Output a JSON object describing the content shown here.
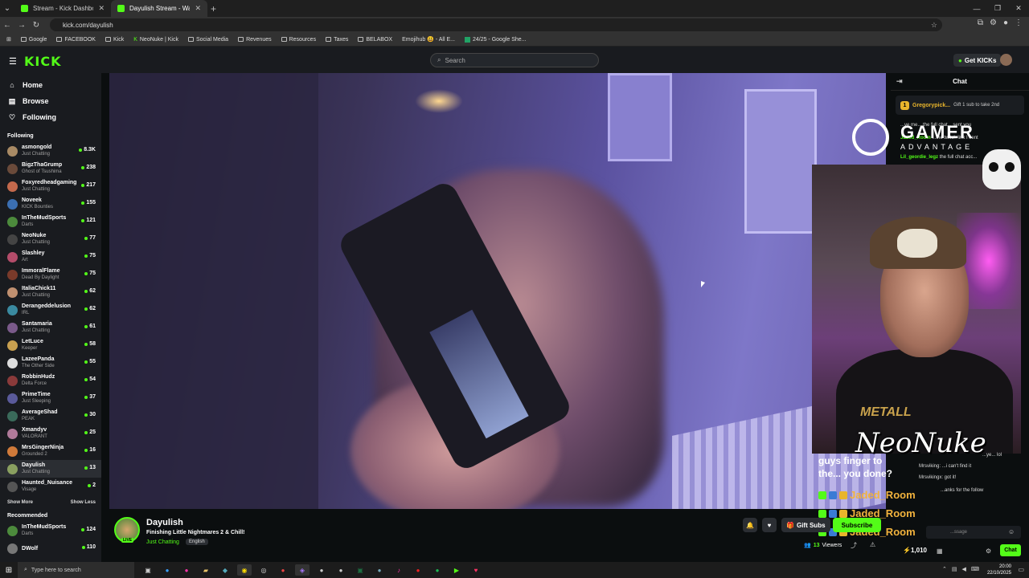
{
  "browser": {
    "tabs": [
      {
        "label": "Stream - Kick Dashboard",
        "active": false
      },
      {
        "label": "Dayulish Stream - Watch Live o",
        "active": true
      }
    ],
    "url": "kick.com/dayulish",
    "bookmarks": [
      "Google",
      "FACEBOOK",
      "Kick",
      "NeoNuke | Kick",
      "Social Media",
      "Revenues",
      "Resources",
      "Taxes",
      "BELABOX",
      "Emojihub 😃 - All E...",
      "24/25 - Google She..."
    ]
  },
  "header": {
    "logo": "KICK",
    "search_placeholder": "Search",
    "get_kicks": "Get KICKs"
  },
  "sidebar": {
    "nav": [
      {
        "label": "Home",
        "icon": "home-icon"
      },
      {
        "label": "Browse",
        "icon": "browse-icon"
      },
      {
        "label": "Following",
        "icon": "heart-icon"
      }
    ],
    "following_title": "Following",
    "following": [
      {
        "name": "asmongold",
        "category": "Just Chatting",
        "viewers": "8.3K",
        "color": "#a88a64"
      },
      {
        "name": "BigzThaGrump",
        "category": "Ghost of Tsushima",
        "viewers": "238",
        "color": "#6a4a3a"
      },
      {
        "name": "Foxyredheadgaming",
        "category": "Just Chatting",
        "viewers": "217",
        "color": "#c4694c"
      },
      {
        "name": "Noveek",
        "category": "KICK Bounties",
        "viewers": "155",
        "color": "#3b6fb2"
      },
      {
        "name": "InTheMudSports",
        "category": "Darts",
        "viewers": "121",
        "color": "#4c8a3c"
      },
      {
        "name": "NeoNuke",
        "category": "Just Chatting",
        "viewers": "77",
        "color": "#444"
      },
      {
        "name": "Slashley",
        "category": "Art",
        "viewers": "75",
        "color": "#b44c6a"
      },
      {
        "name": "ImmoralFlame",
        "category": "Dead By Daylight",
        "viewers": "75",
        "color": "#7a3a2a"
      },
      {
        "name": "ItaliaChick11",
        "category": "Just Chatting",
        "viewers": "62",
        "color": "#c09070"
      },
      {
        "name": "Derangeddelusion",
        "category": "IRL",
        "viewers": "62",
        "color": "#3a8aa0"
      },
      {
        "name": "Santamaria",
        "category": "Just Chatting",
        "viewers": "61",
        "color": "#7a5a8a"
      },
      {
        "name": "LetLuce",
        "category": "Keeper",
        "viewers": "58",
        "color": "#c8a050"
      },
      {
        "name": "LazeePanda",
        "category": "The Other Side",
        "viewers": "55",
        "color": "#ddd"
      },
      {
        "name": "RobbinHudz",
        "category": "Delta Force",
        "viewers": "54",
        "color": "#8a3a3a"
      },
      {
        "name": "PrimeTime",
        "category": "Just Sleeping",
        "viewers": "37",
        "color": "#5a5a9a"
      },
      {
        "name": "AverageShad",
        "category": "PEAK",
        "viewers": "30",
        "color": "#3a6a5a"
      },
      {
        "name": "Xmandyv",
        "category": "VALORANT",
        "viewers": "25",
        "color": "#b07a9a"
      },
      {
        "name": "MrsGingerNinja",
        "category": "Grounded 2",
        "viewers": "16",
        "color": "#d07a3a"
      },
      {
        "name": "Dayulish",
        "category": "Just Chatting",
        "viewers": "13",
        "color": "#8aa060",
        "selected": true
      },
      {
        "name": "Haunted_Nuisance",
        "category": "Visage",
        "viewers": "2",
        "color": "#555"
      }
    ],
    "show_more": "Show More",
    "show_less": "Show Less",
    "recommended_title": "Recommended",
    "recommended": [
      {
        "name": "InTheMudSports",
        "category": "Darts",
        "viewers": "124",
        "color": "#4c8a3c"
      },
      {
        "name": "DWolf",
        "category": "",
        "viewers": "110",
        "color": "#777"
      }
    ]
  },
  "overlay": {
    "sponsor_big": "GAMER",
    "sponsor_small": "ADVANTAGE",
    "signature": "NeoNuke",
    "shirt_text": "METALL",
    "message": "guys finger to the... you done?",
    "user_rows": [
      "Jaded_Room",
      "Jaded_Room",
      "Jaded_Room"
    ],
    "chat_snippets": [
      {
        "text": "...ye... lol"
      },
      {
        "text": "Mrsviking: ...i can't find it"
      },
      {
        "text": "Mrsvikingx: got it!"
      },
      {
        "text": "...anks for the follow"
      }
    ]
  },
  "chat": {
    "title": "Chat",
    "pinned_user": "Gregorypick...",
    "pinned_text": "Gift 1 sub to take 2nd",
    "messages": [
      {
        "user": "",
        "text": "...ve me... the full chat... sent you"
      },
      {
        "user": "Jaded_Room",
        "text": "...the twitch link I sent"
      },
      {
        "user": "Lil_geordie_legz",
        "text": "the full chat acc..."
      }
    ],
    "input_placeholder": "...ssage",
    "points": "1,010",
    "chat_button": "Chat"
  },
  "stream": {
    "name": "Dayulish",
    "title": "Finishing Little Nightmares 2 & Chill!",
    "category": "Just Chatting",
    "language": "English",
    "live_badge": "LIVE",
    "gift_subs": "Gift Subs",
    "subscribe": "Subscribe",
    "viewers_count": "13",
    "viewers_label": "Viewers"
  },
  "taskbar": {
    "search_placeholder": "Type here to search",
    "time": "20:00",
    "date": "22/10/2025"
  }
}
